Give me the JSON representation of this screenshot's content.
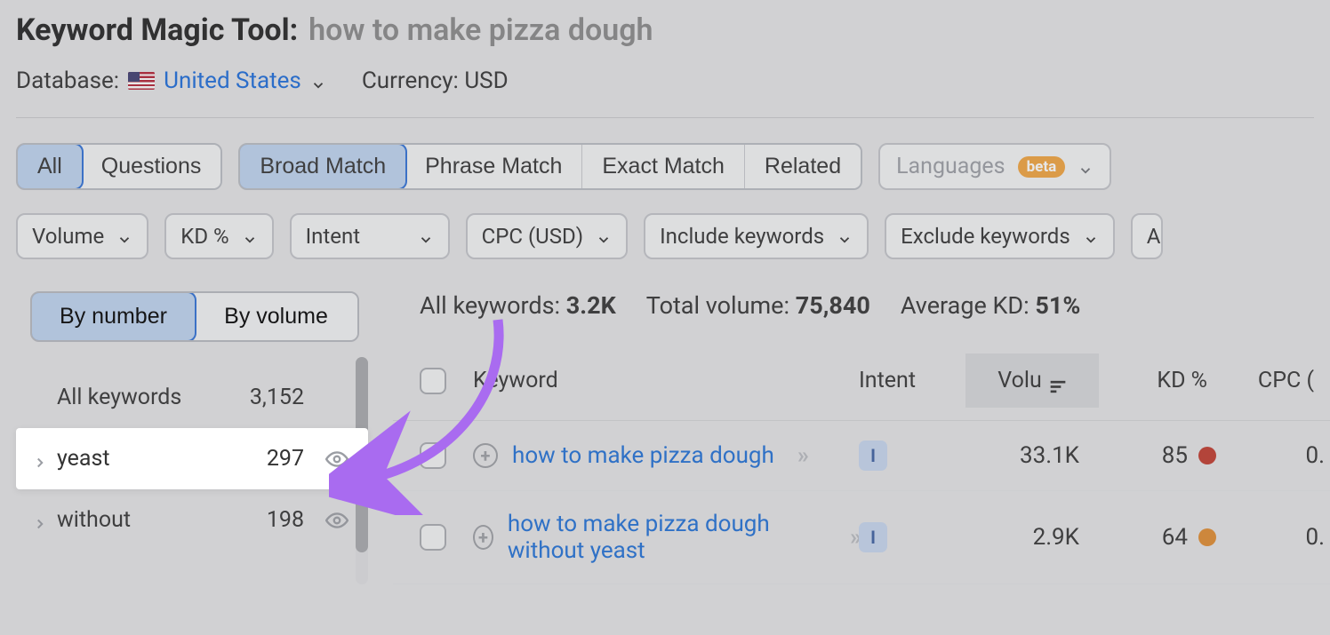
{
  "header": {
    "tool_label": "Keyword Magic Tool:",
    "query": "how to make pizza dough",
    "database_label": "Database:",
    "database_value": "United States",
    "currency_label": "Currency:",
    "currency_value": "USD"
  },
  "type_tabs": {
    "all": "All",
    "questions": "Questions"
  },
  "match_tabs": {
    "broad": "Broad Match",
    "phrase": "Phrase Match",
    "exact": "Exact Match",
    "related": "Related"
  },
  "languages_pill": {
    "label": "Languages",
    "badge": "beta"
  },
  "filters": {
    "volume": "Volume",
    "kd": "KD %",
    "intent": "Intent",
    "cpc": "CPC (USD)",
    "include": "Include keywords",
    "exclude": "Exclude keywords"
  },
  "sidebar": {
    "by_number": "By number",
    "by_volume": "By volume",
    "all_label": "All keywords",
    "all_count": "3,152",
    "groups": [
      {
        "label": "yeast",
        "count": "297"
      },
      {
        "label": "without",
        "count": "198"
      }
    ]
  },
  "stats": {
    "all_kw_label": "All keywords:",
    "all_kw_value": "3.2K",
    "total_vol_label": "Total volume:",
    "total_vol_value": "75,840",
    "avg_kd_label": "Average KD:",
    "avg_kd_value": "51%"
  },
  "columns": {
    "keyword": "Keyword",
    "intent": "Intent",
    "volume": "Volu",
    "kd": "KD %",
    "cpc": "CPC ("
  },
  "rows": [
    {
      "keyword": "how to make pizza dough",
      "intent": "I",
      "volume": "33.1K",
      "kd": "85",
      "kd_color": "red",
      "cpc": "0."
    },
    {
      "keyword": "how to make pizza dough without yeast",
      "intent": "I",
      "volume": "2.9K",
      "kd": "64",
      "kd_color": "orange",
      "cpc": "0."
    }
  ]
}
